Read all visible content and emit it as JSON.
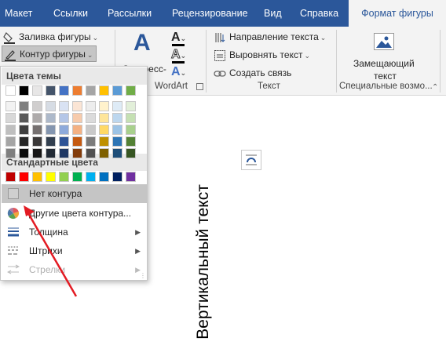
{
  "tabs": [
    {
      "label": "Макет"
    },
    {
      "label": "Ссылки"
    },
    {
      "label": "Рассылки"
    },
    {
      "label": "Рецензирование"
    },
    {
      "label": "Вид"
    },
    {
      "label": "Справка"
    },
    {
      "label": "Формат фигуры",
      "active": true
    }
  ],
  "ribbon": {
    "fill_shape": "Заливка фигуры",
    "outline_shape": "Контур фигуры",
    "express_styles": "Экспресс-",
    "wordart_group": "WordArt",
    "text_direction": "Направление текста",
    "align_text": "Выровнять текст",
    "create_link": "Создать связь",
    "text_group": "Текст",
    "alt_text_line1": "Замещающий",
    "alt_text_line2": "текст",
    "special_group": "Специальные возмо..."
  },
  "menu": {
    "theme_colors_header": "Цвета темы",
    "standard_colors_header": "Стандартные цвета",
    "no_outline": "Нет контура",
    "more_colors": "Другие цвета контура...",
    "weight": "Толщина",
    "dashes": "Штрихи",
    "arrows": "Стрелки",
    "theme_colors_top": [
      "#ffffff",
      "#000000",
      "#e7e6e6",
      "#44546a",
      "#4472c4",
      "#ed7d31",
      "#a5a5a5",
      "#ffc000",
      "#5b9bd5",
      "#70ad47"
    ],
    "theme_colors_shades": [
      [
        "#f2f2f2",
        "#7f7f7f",
        "#d0cece",
        "#d6dce4",
        "#d9e2f3",
        "#fbe5d5",
        "#ededed",
        "#fff2cc",
        "#deebf6",
        "#e2efd9"
      ],
      [
        "#d8d8d8",
        "#595959",
        "#aeabab",
        "#adb9ca",
        "#b4c6e7",
        "#f7cbac",
        "#dbdbdb",
        "#fee599",
        "#bdd7ee",
        "#c5e0b3"
      ],
      [
        "#bfbfbf",
        "#3f3f3f",
        "#757070",
        "#8496b0",
        "#8eaadb",
        "#f4b183",
        "#c9c9c9",
        "#ffd965",
        "#9cc3e5",
        "#a8d08d"
      ],
      [
        "#a5a5a5",
        "#262626",
        "#3a3838",
        "#323f4f",
        "#2f5496",
        "#c55a11",
        "#7b7b7b",
        "#bf9000",
        "#2e75b5",
        "#538135"
      ],
      [
        "#7f7f7f",
        "#0c0c0c",
        "#171616",
        "#222a35",
        "#1f3864",
        "#833c0b",
        "#525252",
        "#7f6000",
        "#1e4e79",
        "#375623"
      ]
    ],
    "standard_colors": [
      "#c00000",
      "#ff0000",
      "#ffc000",
      "#ffff00",
      "#92d050",
      "#00b050",
      "#00b0f0",
      "#0070c0",
      "#002060",
      "#7030a0"
    ]
  },
  "document": {
    "vertical_text": "Вертикальный текст"
  },
  "annotation": {
    "arrow_color": "#e31b23"
  }
}
